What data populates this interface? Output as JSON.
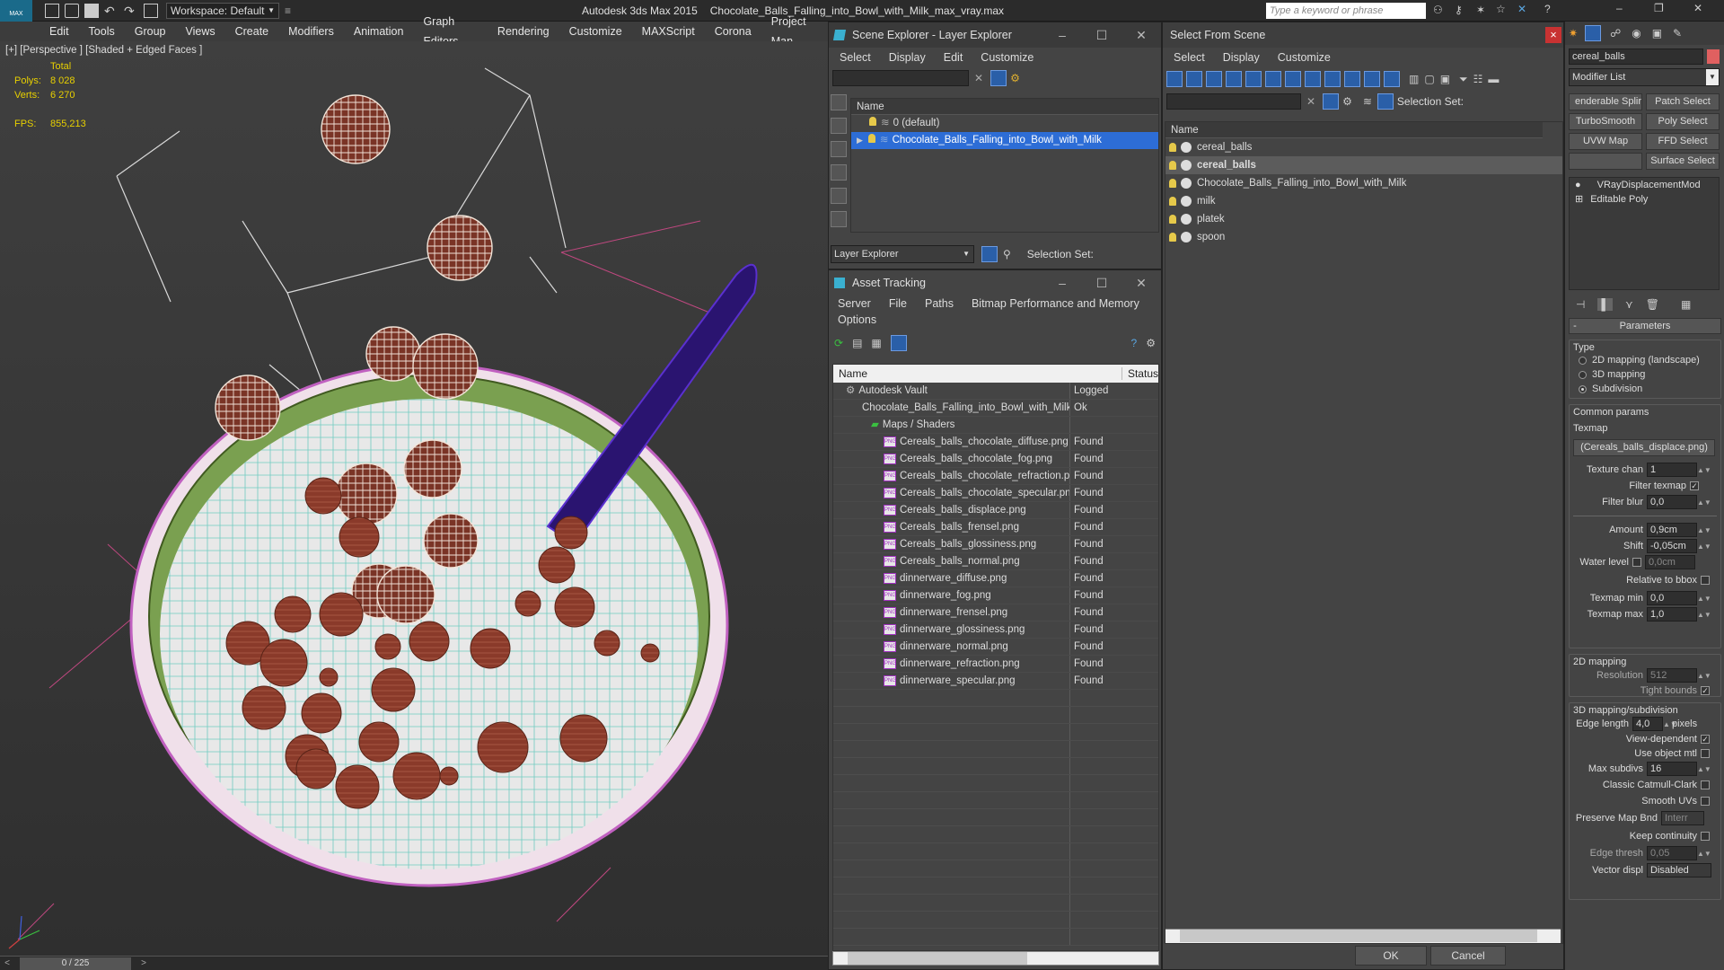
{
  "app": {
    "title": "Autodesk 3ds Max 2015",
    "file": "Chocolate_Balls_Falling_into_Bowl_with_Milk_max_vray.max",
    "workspace": "Workspace: Default",
    "search_placeholder": "Type a keyword or phrase",
    "logo": "MAX"
  },
  "menubar": [
    "Edit",
    "Tools",
    "Group",
    "Views",
    "Create",
    "Modifiers",
    "Animation",
    "Graph Editors",
    "Rendering",
    "Customize",
    "MAXScript",
    "Corona",
    "Project Man"
  ],
  "viewport": {
    "label": "[+] [Perspective ] [Shaded + Edged Faces ]",
    "stats_header": "Total",
    "polys_label": "Polys:",
    "polys": "8 028",
    "verts_label": "Verts:",
    "verts": "6 270",
    "fps_label": "FPS:",
    "fps": "855,213"
  },
  "timeline": {
    "frame": "0 / 225",
    "prev": "<",
    "next": ">"
  },
  "scene_explorer": {
    "title": "Scene Explorer - Layer Explorer",
    "menu": [
      "Select",
      "Display",
      "Edit",
      "Customize"
    ],
    "col_name": "Name",
    "rows": [
      {
        "label": "0 (default)",
        "selected": false
      },
      {
        "label": "Chocolate_Balls_Falling_into_Bowl_with_Milk",
        "selected": true
      }
    ],
    "footer_dropdown": "Layer Explorer",
    "selection_set": "Selection Set:"
  },
  "asset_tracking": {
    "title": "Asset Tracking",
    "menu": [
      "Server",
      "File",
      "Paths",
      "Bitmap Performance and Memory"
    ],
    "menu2": "Options",
    "col_name": "Name",
    "col_status": "Status",
    "rows": [
      {
        "indent": 1,
        "name": "Autodesk Vault",
        "status": "Logged",
        "type": "vault"
      },
      {
        "indent": 2,
        "name": "Chocolate_Balls_Falling_into_Bowl_with_Milk_m...",
        "status": "Ok",
        "type": "max"
      },
      {
        "indent": 3,
        "name": "Maps / Shaders",
        "status": "",
        "type": "folder"
      },
      {
        "indent": 4,
        "name": "Cereals_balls_chocolate_diffuse.png",
        "status": "Found",
        "type": "png"
      },
      {
        "indent": 4,
        "name": "Cereals_balls_chocolate_fog.png",
        "status": "Found",
        "type": "png"
      },
      {
        "indent": 4,
        "name": "Cereals_balls_chocolate_refraction.png",
        "status": "Found",
        "type": "png"
      },
      {
        "indent": 4,
        "name": "Cereals_balls_chocolate_specular.png",
        "status": "Found",
        "type": "png"
      },
      {
        "indent": 4,
        "name": "Cereals_balls_displace.png",
        "status": "Found",
        "type": "png"
      },
      {
        "indent": 4,
        "name": "Cereals_balls_frensel.png",
        "status": "Found",
        "type": "png"
      },
      {
        "indent": 4,
        "name": "Cereals_balls_glossiness.png",
        "status": "Found",
        "type": "png"
      },
      {
        "indent": 4,
        "name": "Cereals_balls_normal.png",
        "status": "Found",
        "type": "png"
      },
      {
        "indent": 4,
        "name": "dinnerware_diffuse.png",
        "status": "Found",
        "type": "png"
      },
      {
        "indent": 4,
        "name": "dinnerware_fog.png",
        "status": "Found",
        "type": "png"
      },
      {
        "indent": 4,
        "name": "dinnerware_frensel.png",
        "status": "Found",
        "type": "png"
      },
      {
        "indent": 4,
        "name": "dinnerware_glossiness.png",
        "status": "Found",
        "type": "png"
      },
      {
        "indent": 4,
        "name": "dinnerware_normal.png",
        "status": "Found",
        "type": "png"
      },
      {
        "indent": 4,
        "name": "dinnerware_refraction.png",
        "status": "Found",
        "type": "png"
      },
      {
        "indent": 4,
        "name": "dinnerware_specular.png",
        "status": "Found",
        "type": "png"
      }
    ],
    "png_badge": "PNG"
  },
  "select_from_scene": {
    "title": "Select From Scene",
    "menu": [
      "Select",
      "Display",
      "Customize"
    ],
    "selection_set": "Selection Set:",
    "col_name": "Name",
    "rows": [
      {
        "label": "cereal_balls",
        "selected": false,
        "bold": false
      },
      {
        "label": "cereal_balls",
        "selected": true,
        "bold": true
      },
      {
        "label": "Chocolate_Balls_Falling_into_Bowl_with_Milk",
        "selected": false,
        "bold": false
      },
      {
        "label": "milk",
        "selected": false,
        "bold": false
      },
      {
        "label": "platek",
        "selected": false,
        "bold": false
      },
      {
        "label": "spoon",
        "selected": false,
        "bold": false
      }
    ],
    "ok": "OK",
    "cancel": "Cancel",
    "close": "×"
  },
  "command_panel": {
    "object_name": "cereal_balls",
    "modifier_list": "Modifier List",
    "buttons": [
      "enderable Splir",
      "Patch Select",
      "TurboSmooth",
      "Poly Select",
      "UVW Map",
      "FFD Select",
      "",
      "Surface Select"
    ],
    "stack": [
      "VRayDisplacementMod",
      "Editable Poly"
    ],
    "rollout": "Parameters",
    "rollout_toggle": "-",
    "type_label": "Type",
    "types": [
      {
        "label": "2D mapping (landscape)",
        "on": false
      },
      {
        "label": "3D mapping",
        "on": false
      },
      {
        "label": "Subdivision",
        "on": true
      }
    ],
    "common_label": "Common params",
    "texmap_label": "Texmap",
    "texmap_value": "(Cereals_balls_displace.png)",
    "texture_chan_label": "Texture chan",
    "texture_chan": "1",
    "filter_texmap_label": "Filter texmap",
    "filter_blur_label": "Filter blur",
    "filter_blur": "0,0",
    "amount_label": "Amount",
    "amount": "0,9cm",
    "shift_label": "Shift",
    "shift": "-0,05cm",
    "water_level_label": "Water level",
    "water_level": "0,0cm",
    "relative_bbox_label": "Relative to bbox",
    "texmap_min_label": "Texmap min",
    "texmap_min": "0,0",
    "texmap_max_label": "Texmap max",
    "texmap_max": "1,0",
    "mapping2d_label": "2D mapping",
    "resolution_label": "Resolution",
    "resolution": "512",
    "tight_bounds_label": "Tight bounds",
    "mapping3d_label": "3D mapping/subdivision",
    "edge_length_label": "Edge length",
    "edge_length": "4,0",
    "pixels_label": "pixels",
    "view_dependent_label": "View-dependent",
    "use_object_mtl_label": "Use object mtl",
    "max_subdivs_label": "Max subdivs",
    "max_subdivs": "16",
    "classic_catmull_label": "Classic Catmull-Clark",
    "smooth_uvs_label": "Smooth UVs",
    "preserve_map_label": "Preserve Map Bnd",
    "preserve_map_value": "Interr",
    "keep_continuity_label": "Keep continuity",
    "edge_thresh_label": "Edge thresh",
    "edge_thresh": "0,05",
    "vector_displ_label": "Vector displ",
    "vector_displ_value": "Disabled"
  },
  "colors": {
    "accent": "#2d6dd6",
    "bg": "#444444",
    "wire_bowl": "#39b5a8",
    "bowl_rim": "#c060c0",
    "ball": "#7a3a28",
    "spoon": "#3a18a0"
  }
}
